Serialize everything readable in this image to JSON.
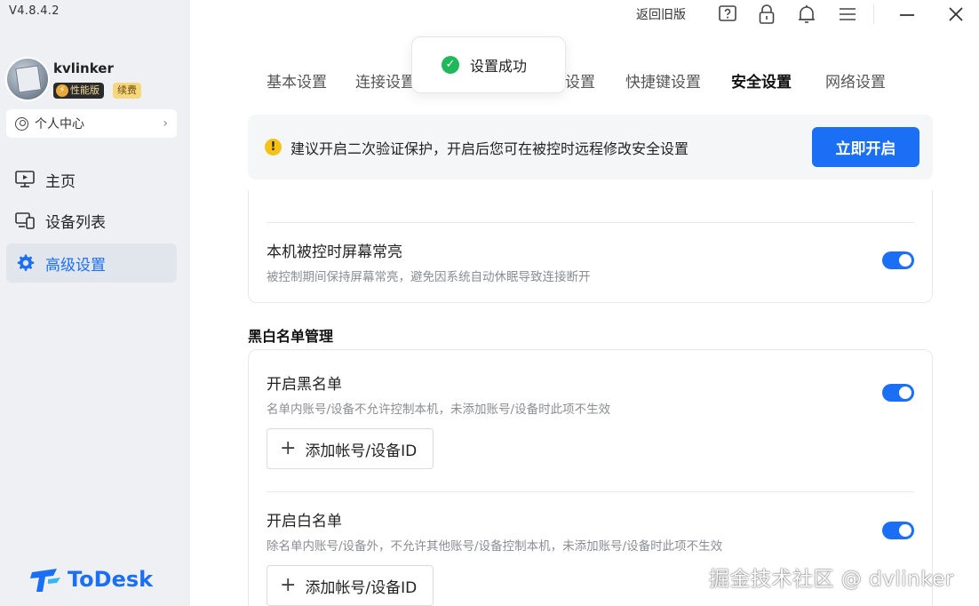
{
  "app": {
    "version": "V4.8.4.2",
    "brand": "ToDesk",
    "accent_color": "#1b6ff5"
  },
  "sidebar": {
    "user": {
      "name": "kvlinker",
      "badge_edition": "性能版",
      "badge_renew": "续费"
    },
    "personal_center": "个人中心",
    "items": [
      {
        "label": "主页",
        "icon": "monitor-icon",
        "active": false
      },
      {
        "label": "设备列表",
        "icon": "devices-icon",
        "active": false
      },
      {
        "label": "高级设置",
        "icon": "gear-icon",
        "active": true
      }
    ]
  },
  "titlebar": {
    "back_old_version": "返回旧版",
    "icons": [
      "help-icon",
      "lock-icon",
      "bell-icon",
      "menu-icon",
      "minimize-icon",
      "close-icon"
    ]
  },
  "tabs": [
    {
      "label": "基本设置",
      "active": false
    },
    {
      "label": "连接设置",
      "active": false
    },
    {
      "label": "设置",
      "active": false
    },
    {
      "label": "快捷键设置",
      "active": false
    },
    {
      "label": "安全设置",
      "active": true
    },
    {
      "label": "网络设置",
      "active": false
    }
  ],
  "toast": {
    "text": "设置成功",
    "status_color": "#1fb85a"
  },
  "banner": {
    "text": "建议开启二次验证保护，开启后您可在被控时远程修改安全设置",
    "button": "立即开启"
  },
  "screen_awake": {
    "title": "本机被控时屏幕常亮",
    "desc": "被控制期间保持屏幕常亮，避免因系统自动休眠导致连接断开",
    "enabled": true
  },
  "blackwhite_section": {
    "title": "黑白名单管理",
    "blacklist": {
      "title": "开启黑名单",
      "desc": "名单内账号/设备不允许控制本机，未添加账号/设备时此项不生效",
      "enabled": true,
      "add_button": "添加帐号/设备ID"
    },
    "whitelist": {
      "title": "开启白名单",
      "desc": "除名单内账号/设备外，不允许其他账号/设备控制本机，未添加账号/设备时此项不生效",
      "enabled": true,
      "add_button": "添加帐号/设备ID"
    }
  },
  "watermark": "掘金技术社区 @ dvlinker"
}
